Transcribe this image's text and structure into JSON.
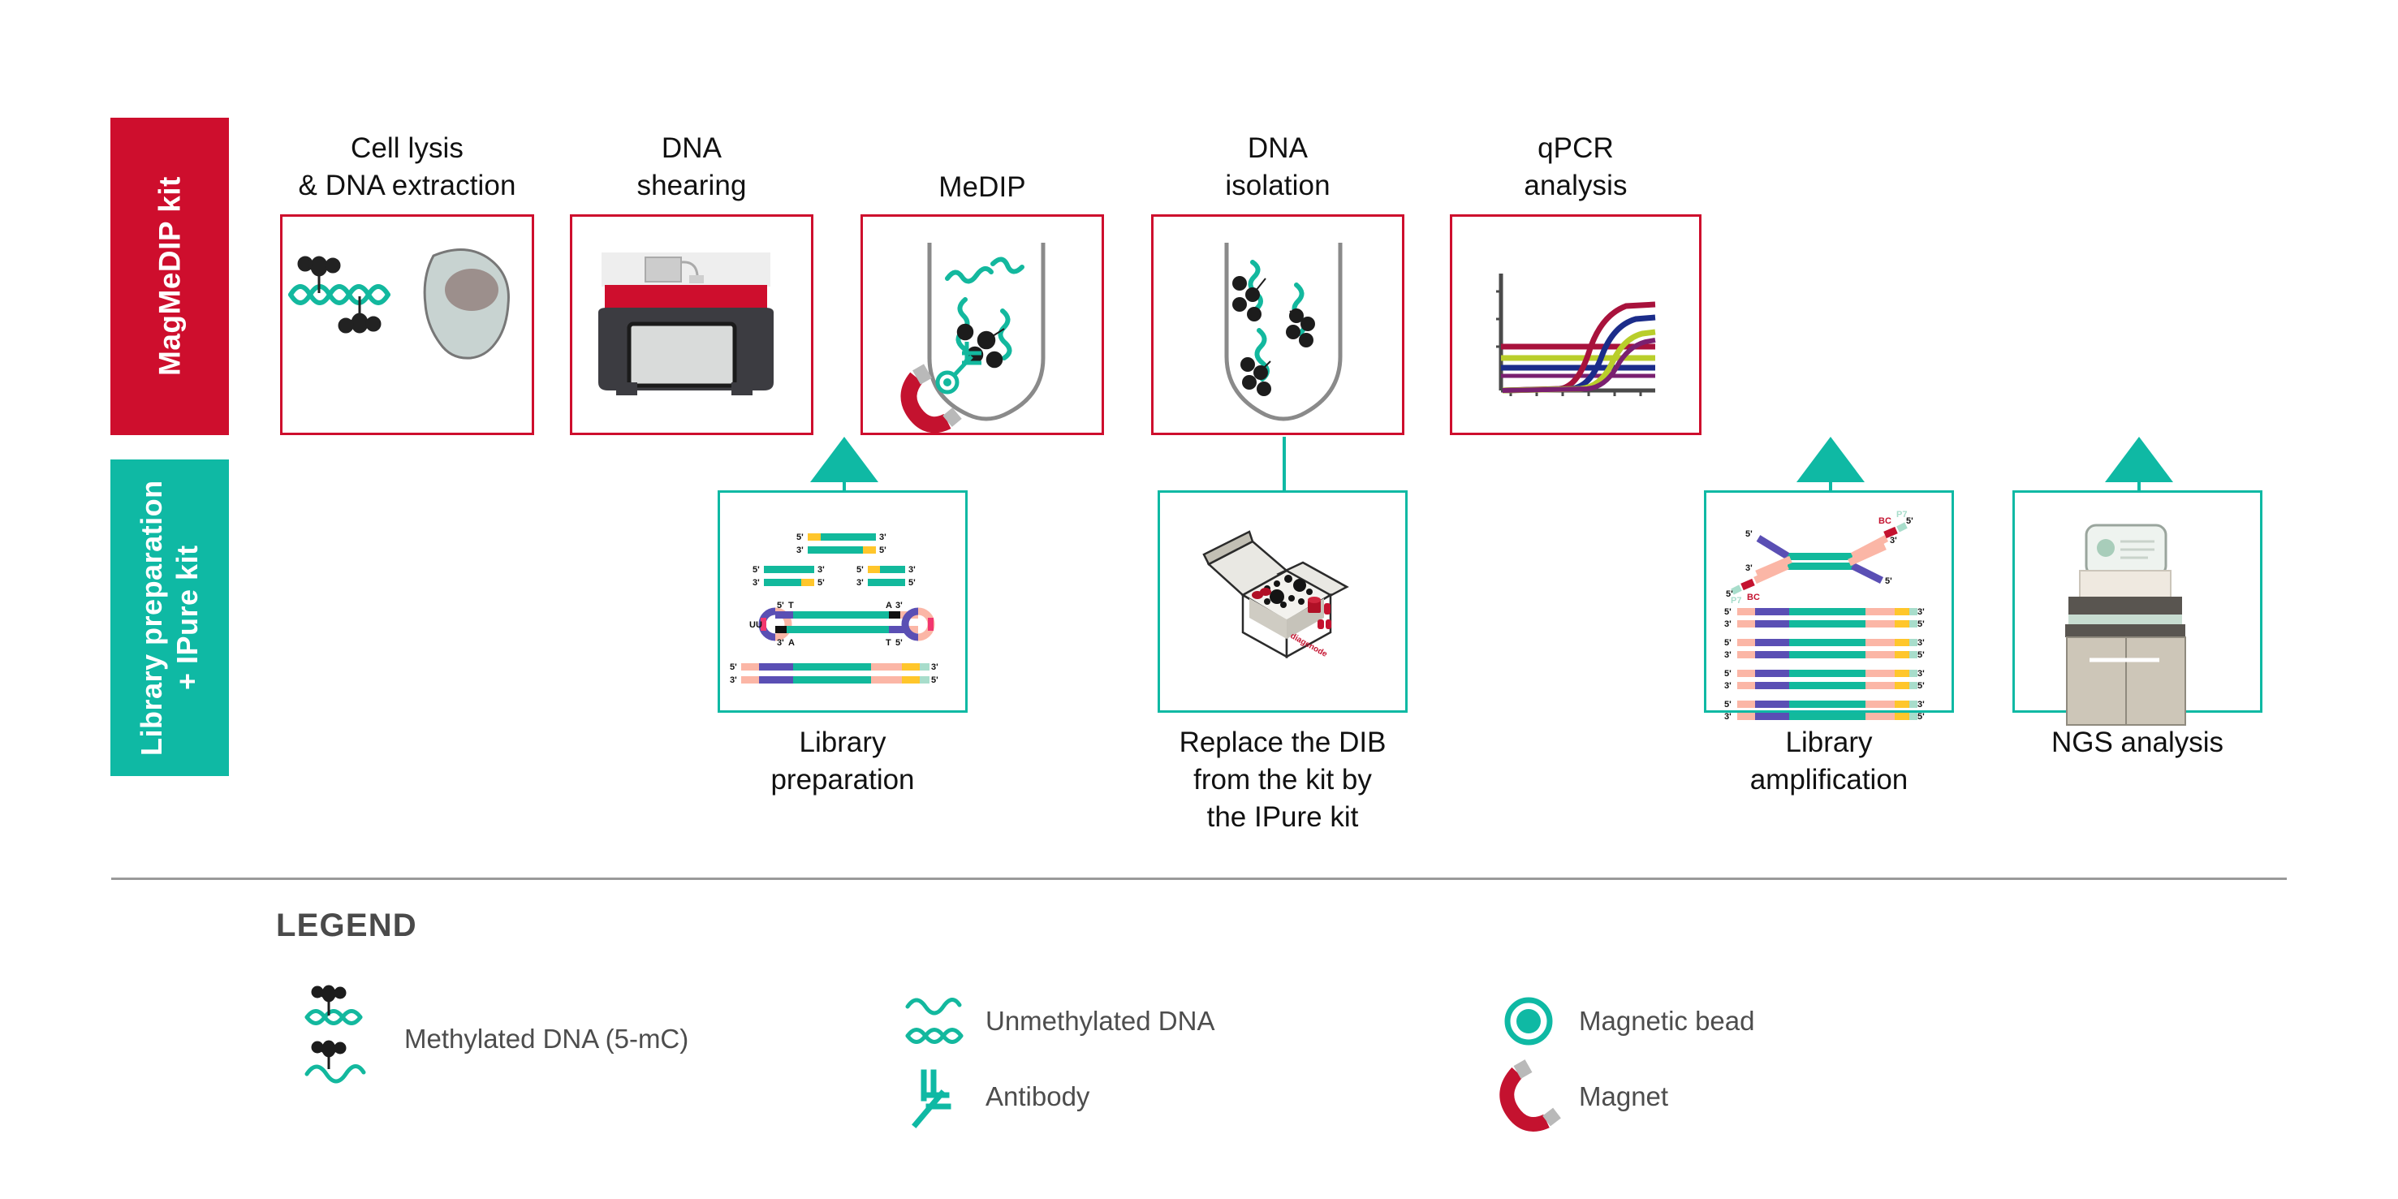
{
  "banners": {
    "medip": "MagMeDIP kit",
    "library": "Library preparation\n+ IPure kit"
  },
  "colors": {
    "red": "#CE0E2D",
    "teal": "#0FB9A4",
    "dna_teal": "#13B89E",
    "dark": "#222222",
    "grey_text": "#4d4d4d",
    "rule": "#9a9a9a"
  },
  "top_row": {
    "steps": [
      {
        "id": "cell-lysis",
        "title": "Cell lysis\n& DNA extraction",
        "icon": "methylated-dna-and-cell-icon"
      },
      {
        "id": "dna-shearing",
        "title": "DNA\nshearing",
        "icon": "sonicator-instrument-icon"
      },
      {
        "id": "medip",
        "title": "MeDIP",
        "icon": "tube-with-magnet-antibody-icon"
      },
      {
        "id": "dna-isolation",
        "title": "DNA\nisolation",
        "icon": "tube-with-beads-dna-icon"
      },
      {
        "id": "qpcr",
        "title": "qPCR\nanalysis",
        "icon": "qpcr-amplification-curves-icon"
      }
    ]
  },
  "bottom_row": {
    "steps": [
      {
        "id": "library-preparation",
        "caption": "Library\npreparation",
        "icon": "library-prep-fragments-icon"
      },
      {
        "id": "replace-dib",
        "caption": "Replace the DIB\nfrom the kit by\nthe IPure kit",
        "icon": "open-kit-box-icon"
      },
      {
        "id": "library-amplification",
        "caption": "Library\namplification",
        "icon": "library-amplification-icon"
      },
      {
        "id": "ngs-analysis",
        "caption": "NGS analysis",
        "icon": "ngs-sequencer-icon"
      }
    ]
  },
  "legend": {
    "title": "LEGEND",
    "items": [
      {
        "id": "methylated-dna",
        "label": "Methylated DNA (5-mC)",
        "icon": "methylated-dna-icon"
      },
      {
        "id": "unmethylated-dna",
        "label": "Unmethylated DNA",
        "icon": "unmethylated-dna-icon"
      },
      {
        "id": "magnetic-bead",
        "label": "Magnetic bead",
        "icon": "magnetic-bead-icon"
      },
      {
        "id": "antibody",
        "label": "Antibody",
        "icon": "antibody-icon"
      },
      {
        "id": "magnet",
        "label": "Magnet",
        "icon": "magnet-icon"
      }
    ]
  },
  "diagram_labels": {
    "library_prep": {
      "five_prime": "5'",
      "three_prime": "3'",
      "adapter_uu": "UU",
      "base_t": "T",
      "base_a": "A"
    },
    "library_amplification": {
      "five_prime": "5'",
      "three_prime": "3'",
      "barcode": "BC",
      "primer": "P7"
    }
  },
  "qpcr_chart": {
    "type": "line",
    "title": "",
    "xlabel": "",
    "ylabel": "",
    "grid": false,
    "legend": "none",
    "series": [
      {
        "name": "curve-1",
        "color": "#A8123C",
        "threshold_y": 0.6,
        "ct": 0.42,
        "plateau": 0.88
      },
      {
        "name": "curve-2",
        "color": "#1B2C8A",
        "threshold_y": 0.46,
        "ct": 0.52,
        "plateau": 0.78
      },
      {
        "name": "curve-3",
        "color": "#B9CE2B",
        "threshold_y": 0.53,
        "ct": 0.58,
        "plateau": 0.68
      },
      {
        "name": "curve-4",
        "color": "#7A2070",
        "threshold_y": 0.5,
        "ct": 0.62,
        "plateau": 0.64
      }
    ]
  }
}
